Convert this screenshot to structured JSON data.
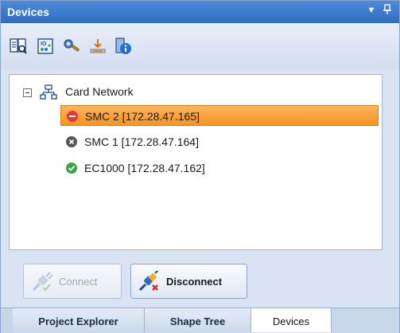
{
  "window": {
    "title": "Devices"
  },
  "toolbar": {
    "buttons": [
      {
        "icon": "device-list-icon"
      },
      {
        "icon": "io-module-icon"
      },
      {
        "icon": "settings-tools-icon"
      },
      {
        "icon": "download-icon"
      },
      {
        "icon": "device-info-icon"
      }
    ]
  },
  "tree": {
    "root": {
      "label": "Card Network",
      "expanded": true
    },
    "devices": [
      {
        "label": "SMC 2 [172.28.47.165]",
        "status": "error",
        "selected": true
      },
      {
        "label": "SMC 1 [172.28.47.164]",
        "status": "disconnected",
        "selected": false
      },
      {
        "label": "EC1000 [172.28.47.162]",
        "status": "ok",
        "selected": false
      }
    ]
  },
  "actions": {
    "connect_label": "Connect",
    "connect_enabled": false,
    "disconnect_label": "Disconnect",
    "disconnect_enabled": true
  },
  "tabs": [
    {
      "label": "Project Explorer",
      "active": false
    },
    {
      "label": "Shape Tree",
      "active": false
    },
    {
      "label": "Devices",
      "active": true
    }
  ],
  "colors": {
    "title_bar": "#2f6cc0",
    "selection": "#f7931e",
    "status_error": "#e03a3a",
    "status_disconnected": "#555555",
    "status_ok": "#3aa545"
  }
}
